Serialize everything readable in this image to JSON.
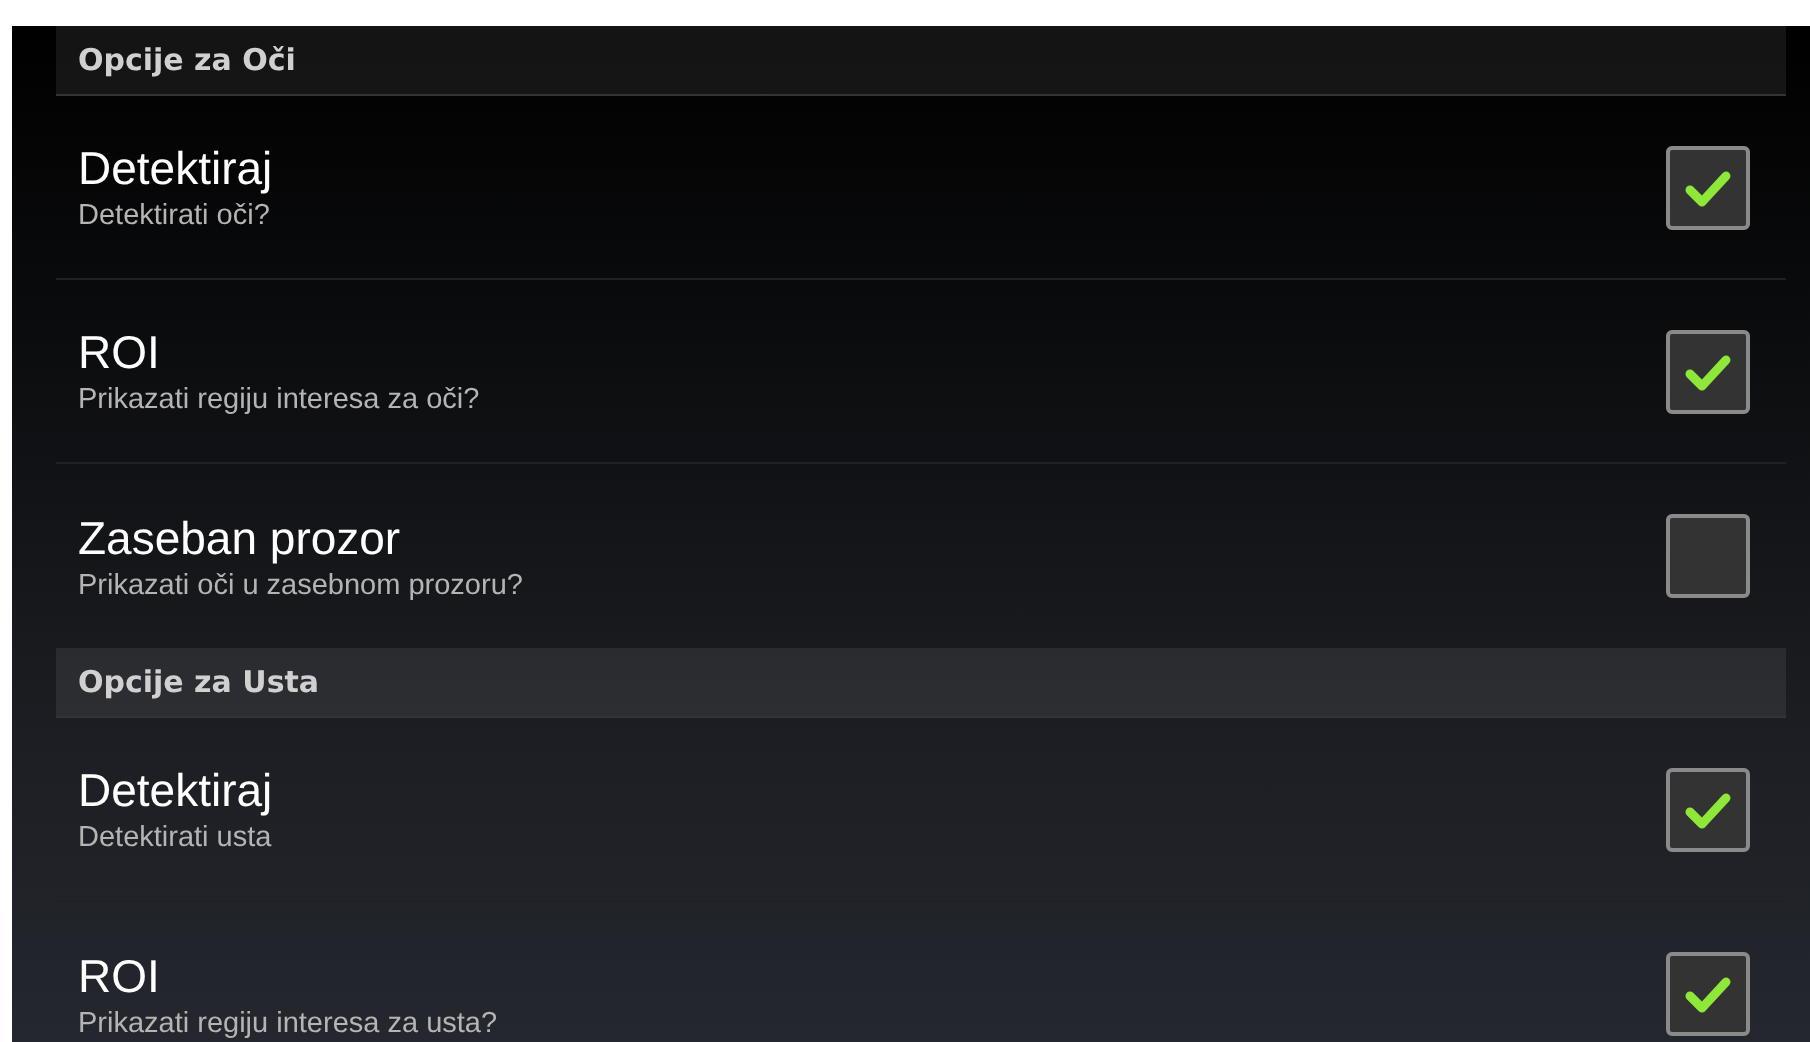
{
  "sections": [
    {
      "title": "Opcije za Oči",
      "items": [
        {
          "title": "Detektiraj",
          "summary": "Detektirati oči?",
          "checked": true
        },
        {
          "title": "ROI",
          "summary": "Prikazati regiju interesa za oči?",
          "checked": true
        },
        {
          "title": "Zaseban prozor",
          "summary": "Prikazati oči u zasebnom prozoru?",
          "checked": false
        }
      ]
    },
    {
      "title": "Opcije za Usta",
      "items": [
        {
          "title": "Detektiraj",
          "summary": "Detektirati usta",
          "checked": true
        },
        {
          "title": "ROI",
          "summary": "Prikazati regiju interesa za usta?",
          "checked": true
        }
      ]
    }
  ]
}
